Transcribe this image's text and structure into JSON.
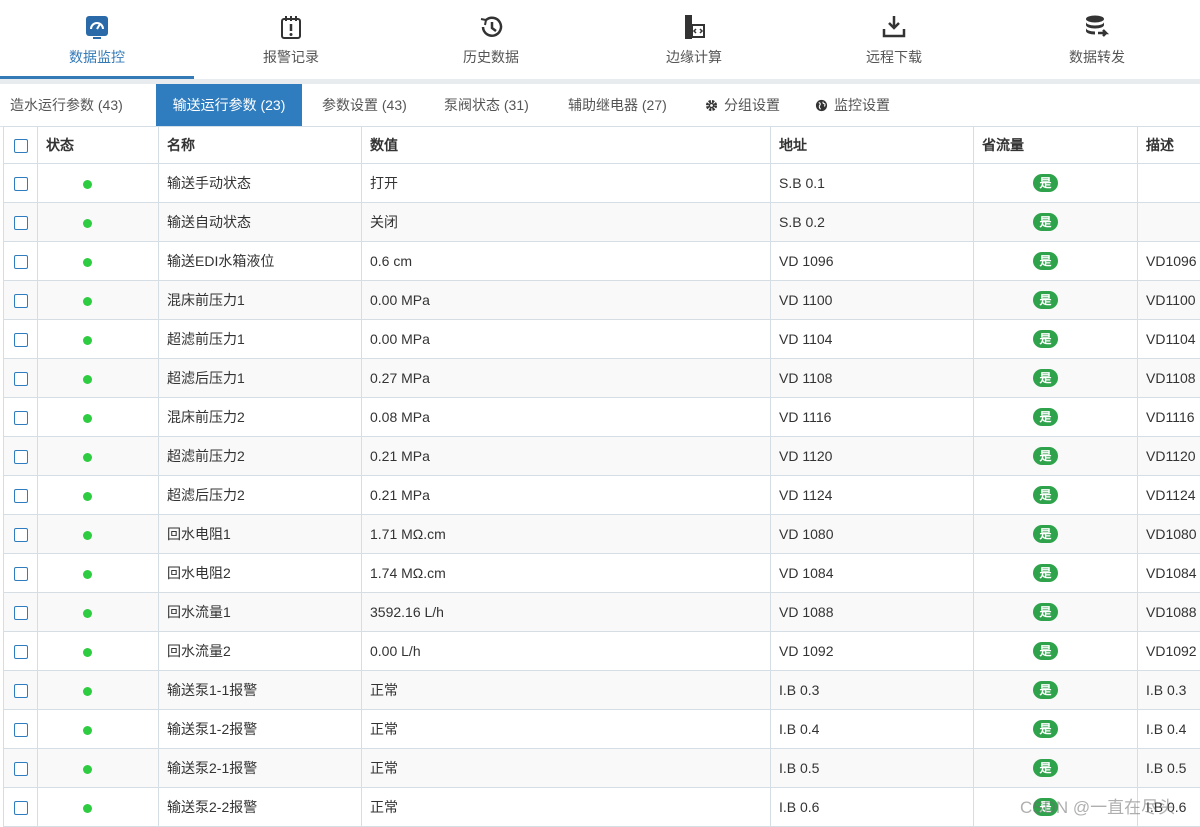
{
  "nav": [
    {
      "label": "数据监控",
      "icon": "dashboard-icon"
    },
    {
      "label": "报警记录",
      "icon": "alarm-record-icon"
    },
    {
      "label": "历史数据",
      "icon": "history-icon"
    },
    {
      "label": "边缘计算",
      "icon": "edge-compute-icon"
    },
    {
      "label": "远程下载",
      "icon": "download-icon"
    },
    {
      "label": "数据转发",
      "icon": "database-forward-icon"
    }
  ],
  "tabs": [
    {
      "label": "造水运行参数 (43)"
    },
    {
      "label": "输送运行参数 (23)"
    },
    {
      "label": "参数设置 (43)"
    },
    {
      "label": "泵阀状态 (31)"
    },
    {
      "label": "辅助继电器 (27)"
    },
    {
      "label": "分组设置",
      "icon": "gear-icon"
    },
    {
      "label": "监控设置",
      "icon": "globe-icon"
    }
  ],
  "table": {
    "headers": {
      "status": "状态",
      "name": "名称",
      "value": "数值",
      "address": "地址",
      "save_flow": "省流量",
      "desc": "描述"
    },
    "rows": [
      {
        "name": "输送手动状态",
        "value": "打开",
        "address": "S.B 0.1",
        "save_flow": "是",
        "desc": ""
      },
      {
        "name": "输送自动状态",
        "value": "关闭",
        "address": "S.B 0.2",
        "save_flow": "是",
        "desc": ""
      },
      {
        "name": "输送EDI水箱液位",
        "value": "0.6 cm",
        "address": "VD 1096",
        "save_flow": "是",
        "desc": "VD1096"
      },
      {
        "name": "混床前压力1",
        "value": "0.00 MPa",
        "address": "VD 1100",
        "save_flow": "是",
        "desc": "VD1100"
      },
      {
        "name": "超滤前压力1",
        "value": "0.00 MPa",
        "address": "VD 1104",
        "save_flow": "是",
        "desc": "VD1104"
      },
      {
        "name": "超滤后压力1",
        "value": "0.27 MPa",
        "address": "VD 1108",
        "save_flow": "是",
        "desc": "VD1108"
      },
      {
        "name": "混床前压力2",
        "value": "0.08 MPa",
        "address": "VD 1116",
        "save_flow": "是",
        "desc": "VD1116"
      },
      {
        "name": "超滤前压力2",
        "value": "0.21 MPa",
        "address": "VD 1120",
        "save_flow": "是",
        "desc": "VD1120"
      },
      {
        "name": "超滤后压力2",
        "value": "0.21 MPa",
        "address": "VD 1124",
        "save_flow": "是",
        "desc": "VD1124"
      },
      {
        "name": "回水电阻1",
        "value": "1.71 MΩ.cm",
        "address": "VD 1080",
        "save_flow": "是",
        "desc": "VD1080"
      },
      {
        "name": "回水电阻2",
        "value": "1.74 MΩ.cm",
        "address": "VD 1084",
        "save_flow": "是",
        "desc": "VD1084"
      },
      {
        "name": "回水流量1",
        "value": "3592.16 L/h",
        "address": "VD 1088",
        "save_flow": "是",
        "desc": "VD1088"
      },
      {
        "name": "回水流量2",
        "value": "0.00 L/h",
        "address": "VD 1092",
        "save_flow": "是",
        "desc": "VD1092"
      },
      {
        "name": "输送泵1-1报警",
        "value": "正常",
        "address": "I.B 0.3",
        "save_flow": "是",
        "desc": "I.B 0.3"
      },
      {
        "name": "输送泵1-2报警",
        "value": "正常",
        "address": "I.B 0.4",
        "save_flow": "是",
        "desc": "I.B 0.4"
      },
      {
        "name": "输送泵2-1报警",
        "value": "正常",
        "address": "I.B 0.5",
        "save_flow": "是",
        "desc": "I.B 0.5"
      },
      {
        "name": "输送泵2-2报警",
        "value": "正常",
        "address": "I.B 0.6",
        "save_flow": "是",
        "desc": "I.B 0.6"
      }
    ]
  },
  "colors": {
    "accent": "#337ab7",
    "active_tab": "#2f7cbf",
    "status_on": "#2ecc40",
    "badge": "#2fa24c"
  },
  "watermark": "CSDN @一直在尽头"
}
